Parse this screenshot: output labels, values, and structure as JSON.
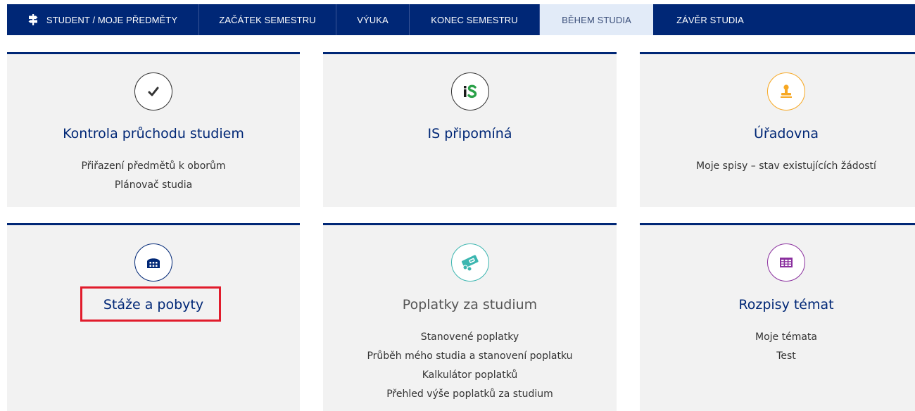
{
  "nav": {
    "tabs": [
      {
        "label": "STUDENT / MOJE PŘEDMĚTY",
        "icon": "signpost-icon"
      },
      {
        "label": "ZAČÁTEK SEMESTRU"
      },
      {
        "label": "VÝUKA"
      },
      {
        "label": "KONEC SEMESTRU"
      },
      {
        "label": "BĚHEM STUDIA",
        "active": true
      },
      {
        "label": "ZÁVĚR STUDIA"
      }
    ]
  },
  "colors": {
    "nav_bg": "#002776",
    "active_tab_bg": "#e2ebf8",
    "tile_bg": "#f2f2f2",
    "highlight": "#e11c2c"
  },
  "tiles": [
    {
      "title": "Kontrola průchodu studiem",
      "icon": "checkmark-icon",
      "icon_color": "#333333",
      "links": [
        "Přiřazení předmětů k oborům",
        "Plánovač studia"
      ]
    },
    {
      "title": "IS připomíná",
      "icon": "is-logo-icon",
      "icon_color": "#333333",
      "links": []
    },
    {
      "title": "Úřadovna",
      "icon": "stamp-icon",
      "icon_color": "#f7a823",
      "links": [
        "Moje spisy – stav existujících žádostí"
      ]
    },
    {
      "title": "Stáže a pobyty",
      "icon": "building-icon",
      "icon_color": "#002776",
      "links": []
    },
    {
      "title": "Poplatky za studium",
      "icon": "money-icon",
      "icon_color": "#3bb6b0",
      "links": [
        "Stanovené poplatky",
        "Průběh mého studia a stanovení poplatku",
        "Kalkulátor poplatků",
        "Přehled výše poplatků za studium"
      ]
    },
    {
      "title": "Rozpisy témat",
      "icon": "table-icon",
      "icon_color": "#8a2f9e",
      "links": [
        "Moje témata",
        "Test"
      ]
    }
  ]
}
